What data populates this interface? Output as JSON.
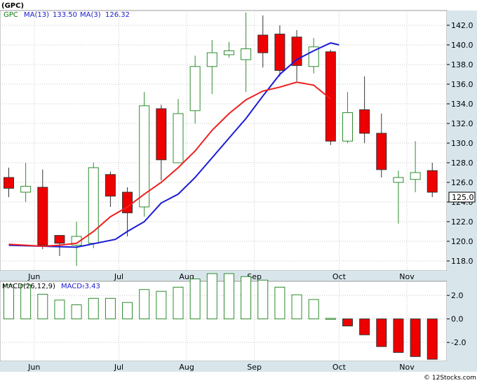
{
  "header": {
    "symbol": "(GPC)",
    "ticker_short": "GPC",
    "ma13_label": "MA(13)",
    "ma13_value": "133.50",
    "ma3_label": "MA(3)",
    "ma3_value": "126.32",
    "macd_params": "MACD(26,12,9)",
    "macd_label": "MACD:",
    "macd_value": "-3.43"
  },
  "watermark": "© 12Stocks.com",
  "last_price_badge": "125.0",
  "colors": {
    "up": "#2e8b2e",
    "down": "#ee0000",
    "ma13": "#1a1ad6",
    "ma3": "#ee2020",
    "axis_bg": "#d8e6ec",
    "grid": "#c8c8c8"
  },
  "chart_data": [
    {
      "type": "candlestick",
      "title": "(GPC)",
      "x_tick_labels": [
        "Jun",
        "Jul",
        "Aug",
        "Sep",
        "Oct",
        "Nov"
      ],
      "x_tick_positions": [
        1.5,
        6.5,
        10.5,
        14.5,
        19.5,
        23.5
      ],
      "ylim": [
        117,
        143.5
      ],
      "y_ticks": [
        118,
        120,
        122,
        124,
        126,
        128,
        130,
        132,
        134,
        136,
        138,
        140,
        142
      ],
      "grid": true,
      "ohlc": [
        {
          "o": 126.5,
          "h": 127.5,
          "l": 124.5,
          "c": 125.4
        },
        {
          "o": 125.0,
          "h": 128.0,
          "l": 124.0,
          "c": 125.6
        },
        {
          "o": 125.5,
          "h": 127.3,
          "l": 119.2,
          "c": 119.6
        },
        {
          "o": 120.6,
          "h": 120.6,
          "l": 118.5,
          "c": 119.8
        },
        {
          "o": 119.6,
          "h": 122.0,
          "l": 117.5,
          "c": 120.5
        },
        {
          "o": 119.8,
          "h": 128.0,
          "l": 119.3,
          "c": 127.5
        },
        {
          "o": 126.8,
          "h": 127.1,
          "l": 123.5,
          "c": 124.6
        },
        {
          "o": 125.0,
          "h": 125.5,
          "l": 120.5,
          "c": 122.9
        },
        {
          "o": 123.5,
          "h": 135.2,
          "l": 122.5,
          "c": 133.8
        },
        {
          "o": 133.5,
          "h": 133.9,
          "l": 126.2,
          "c": 128.3
        },
        {
          "o": 128.0,
          "h": 134.5,
          "l": 128.0,
          "c": 133.0
        },
        {
          "o": 133.3,
          "h": 138.9,
          "l": 132.0,
          "c": 137.8
        },
        {
          "o": 137.8,
          "h": 140.5,
          "l": 135.0,
          "c": 139.2
        },
        {
          "o": 139.0,
          "h": 140.3,
          "l": 138.7,
          "c": 139.4
        },
        {
          "o": 138.5,
          "h": 143.3,
          "l": 135.2,
          "c": 139.6
        },
        {
          "o": 141.0,
          "h": 143.0,
          "l": 137.7,
          "c": 139.2
        },
        {
          "o": 141.1,
          "h": 142.0,
          "l": 136.8,
          "c": 137.4
        },
        {
          "o": 140.8,
          "h": 141.5,
          "l": 136.3,
          "c": 137.9
        },
        {
          "o": 137.8,
          "h": 140.7,
          "l": 137.1,
          "c": 139.8
        },
        {
          "o": 139.3,
          "h": 139.5,
          "l": 129.8,
          "c": 130.2
        },
        {
          "o": 130.2,
          "h": 135.2,
          "l": 130.0,
          "c": 133.1
        },
        {
          "o": 133.4,
          "h": 136.8,
          "l": 130.0,
          "c": 131.0
        },
        {
          "o": 131.0,
          "h": 133.0,
          "l": 126.5,
          "c": 127.3
        },
        {
          "o": 126.0,
          "h": 127.2,
          "l": 121.8,
          "c": 126.5
        },
        {
          "o": 126.3,
          "h": 130.2,
          "l": 125.0,
          "c": 127.0
        },
        {
          "o": 127.2,
          "h": 128.0,
          "l": 124.5,
          "c": 125.0
        }
      ],
      "series": [
        {
          "name": "MA(13)",
          "x": [
            0,
            4,
            6.3,
            7,
            8,
            9,
            10,
            11,
            12,
            13,
            14,
            15,
            16,
            17,
            18,
            19,
            19.5
          ],
          "values": [
            119.6,
            119.4,
            120.2,
            121.0,
            122.0,
            123.9,
            124.8,
            126.5,
            128.5,
            130.5,
            132.5,
            134.8,
            137.0,
            138.5,
            139.4,
            140.2,
            140.0
          ]
        },
        {
          "name": "MA(3)",
          "x": [
            0,
            2,
            3,
            4,
            5,
            6,
            7,
            8,
            9,
            10,
            11,
            12,
            13,
            14,
            15,
            16,
            17,
            18,
            19
          ],
          "values": [
            119.7,
            119.5,
            119.6,
            119.8,
            121.0,
            122.5,
            123.5,
            124.8,
            126.0,
            127.5,
            129.2,
            131.3,
            133.0,
            134.4,
            135.3,
            135.7,
            136.2,
            135.9,
            134.5
          ]
        }
      ]
    },
    {
      "type": "bar",
      "title": "MACD(26,12,9)",
      "x_tick_labels": [
        "Jun",
        "Jul",
        "Aug",
        "Sep",
        "Oct",
        "Nov"
      ],
      "ylim": [
        -3.6,
        3.2
      ],
      "y_ticks": [
        2.0,
        0.0,
        -2.0
      ],
      "y_tick_labels": [
        "2.0",
        "0.0",
        "-2.0"
      ],
      "values": [
        2.9,
        2.9,
        2.1,
        1.6,
        1.2,
        1.75,
        1.75,
        1.4,
        2.5,
        2.35,
        2.7,
        3.4,
        3.85,
        3.85,
        3.6,
        3.3,
        2.7,
        2.05,
        1.65,
        0.05,
        -0.6,
        -1.35,
        -2.35,
        -2.85,
        -3.2,
        -3.43
      ]
    }
  ]
}
